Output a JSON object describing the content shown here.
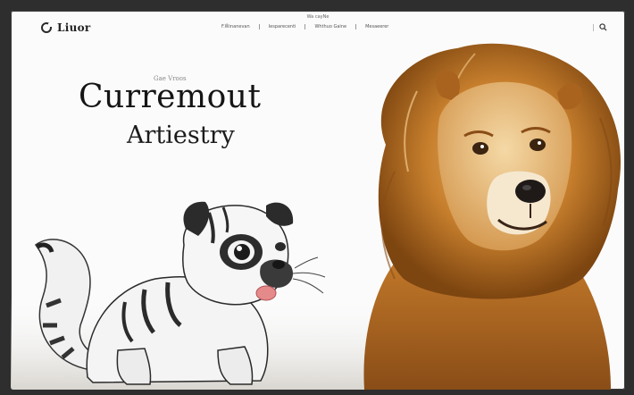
{
  "brand": {
    "name": "Liuor",
    "icon": "brand-logo-icon"
  },
  "nav": {
    "top_label": "Wa cayNe",
    "items": [
      "F.W̃ınanevan",
      "Iesparecenti",
      "Whthuo Gaine",
      "Mesaeerer"
    ]
  },
  "header": {
    "icons": [
      "search-icon"
    ]
  },
  "hero": {
    "kicker": "Gae Vroos",
    "title_line1": "Curremout",
    "title_line2": "Artiestry"
  },
  "illustrations": {
    "left": "cartoon-pug-cat-illustration",
    "right": "lion-dog-illustration"
  },
  "colors": {
    "background": "#fbfbfb",
    "frame": "#2e2e2e",
    "text": "#151515",
    "mane": "#c8822f"
  }
}
